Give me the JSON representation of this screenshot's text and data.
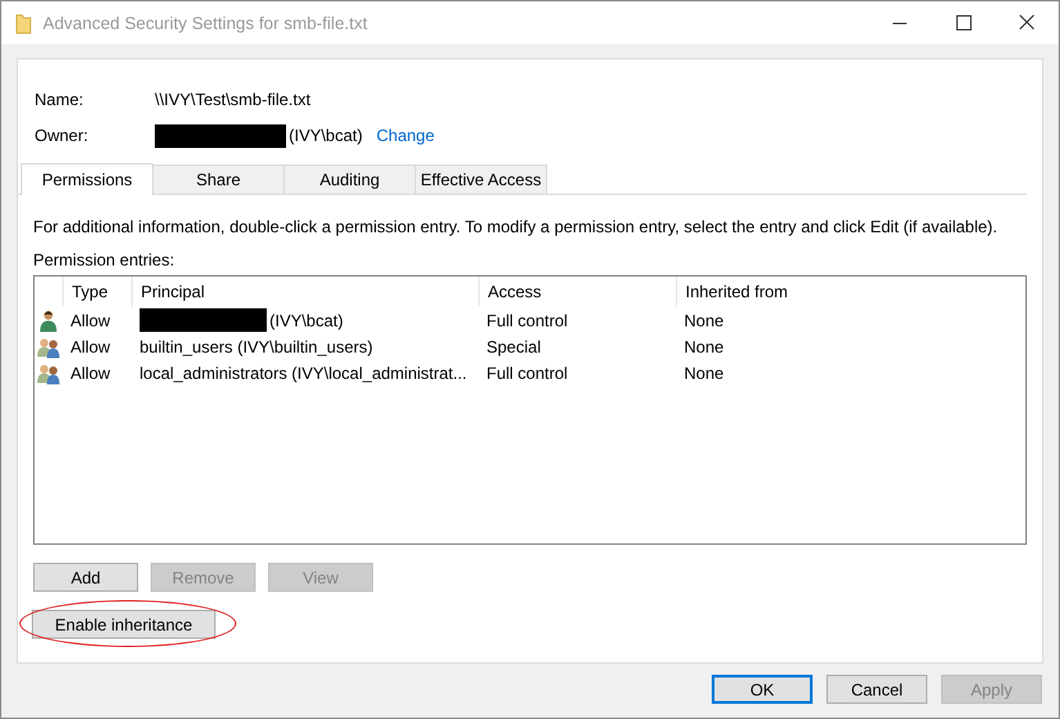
{
  "window": {
    "title": "Advanced Security Settings for smb-file.txt"
  },
  "name": {
    "label": "Name:",
    "value": "\\\\IVY\\Test\\smb-file.txt"
  },
  "owner": {
    "label": "Owner:",
    "value": "(IVY\\bcat)",
    "link": "Change"
  },
  "tabs": [
    {
      "label": "Permissions",
      "selected": true
    },
    {
      "label": "Share",
      "selected": false
    },
    {
      "label": "Auditing",
      "selected": false
    },
    {
      "label": "Effective Access",
      "selected": false
    }
  ],
  "info": "For additional information, double-click a permission entry. To modify a permission entry, select the entry and click Edit (if available).",
  "entries_label": "Permission entries:",
  "table": {
    "columns": [
      "Type",
      "Principal",
      "Access",
      "Inherited from"
    ],
    "rows": [
      {
        "kind": "user",
        "type": "Allow",
        "redacted": true,
        "principal": "(IVY\\bcat)",
        "access": "Full control",
        "inherited": "None"
      },
      {
        "kind": "group",
        "type": "Allow",
        "redacted": false,
        "principal": "builtin_users (IVY\\builtin_users)",
        "access": "Special",
        "inherited": "None"
      },
      {
        "kind": "group",
        "type": "Allow",
        "redacted": false,
        "principal": "local_administrators (IVY\\local_administrat...",
        "access": "Full control",
        "inherited": "None"
      }
    ]
  },
  "actions": [
    {
      "label": "Add",
      "disabled": false
    },
    {
      "label": "Remove",
      "disabled": true
    },
    {
      "label": "View",
      "disabled": true
    }
  ],
  "inheritance": {
    "label": "Enable inheritance",
    "highlighted": true
  },
  "buttons": [
    {
      "label": "OK",
      "disabled": false,
      "default": true
    },
    {
      "label": "Cancel",
      "disabled": false,
      "default": false
    },
    {
      "label": "Apply",
      "disabled": true,
      "default": false
    }
  ]
}
